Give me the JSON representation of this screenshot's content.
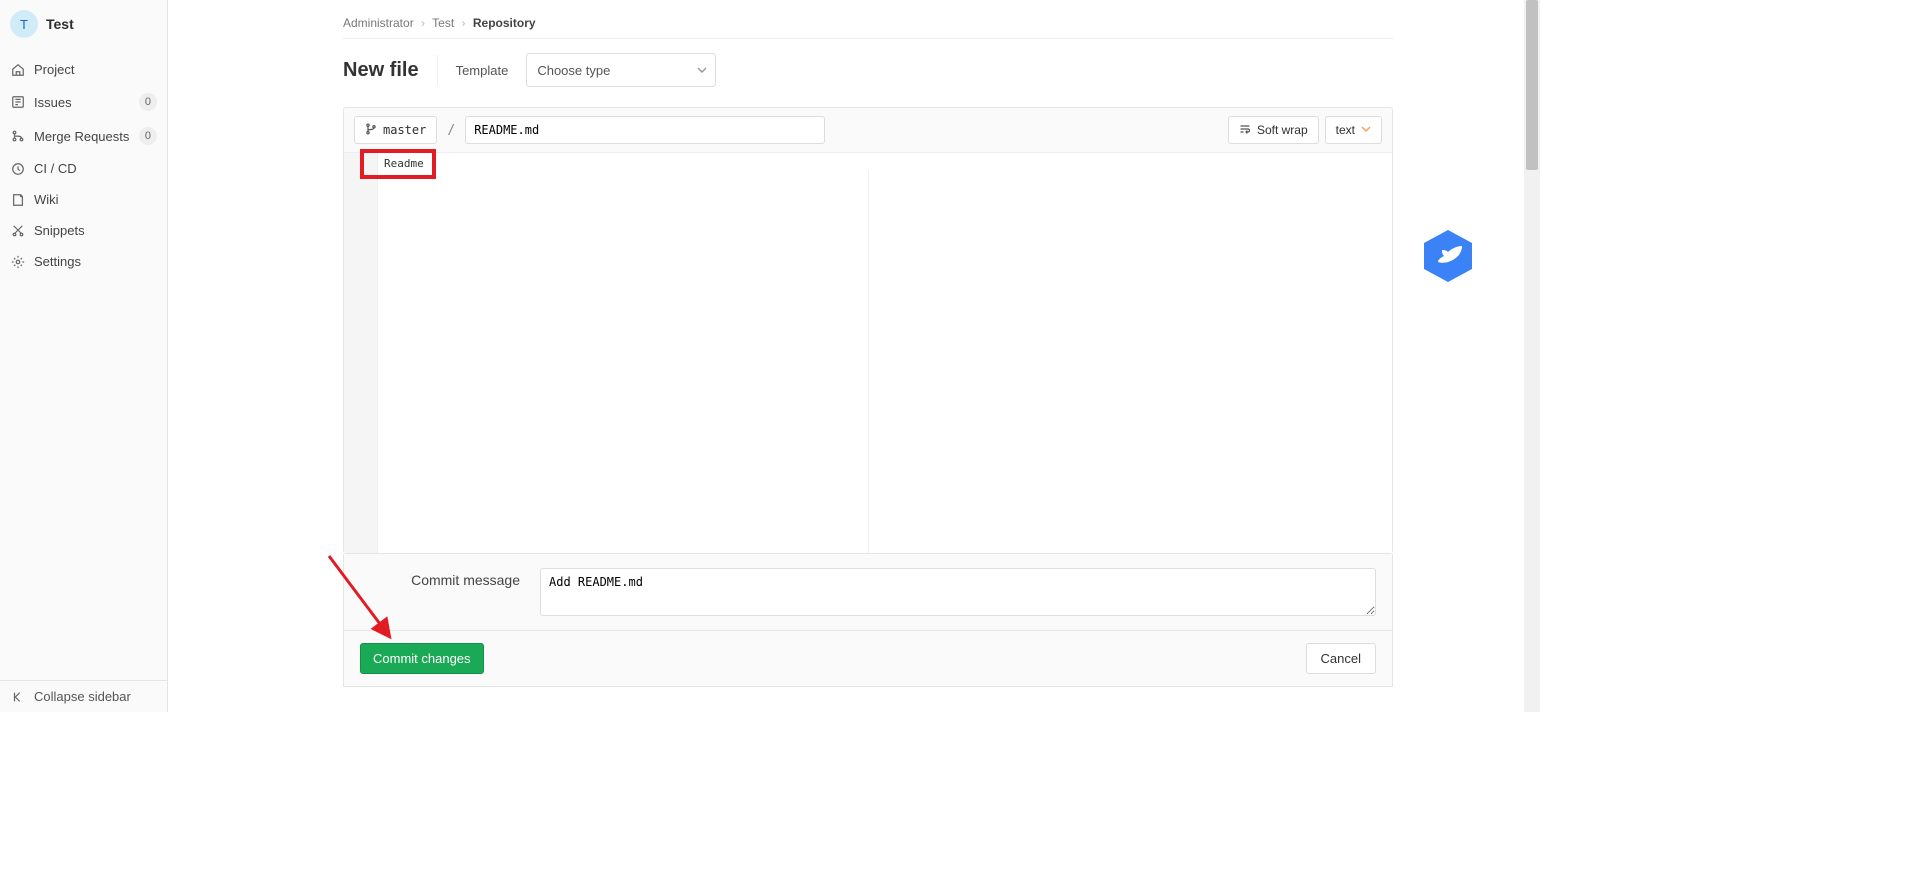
{
  "sidebar": {
    "project_avatar_letter": "T",
    "project_name": "Test",
    "items": [
      {
        "label": "Project",
        "icon": "home"
      },
      {
        "label": "Issues",
        "icon": "issues",
        "badge": "0"
      },
      {
        "label": "Merge Requests",
        "icon": "merge",
        "badge": "0"
      },
      {
        "label": "CI / CD",
        "icon": "cicd"
      },
      {
        "label": "Wiki",
        "icon": "wiki"
      },
      {
        "label": "Snippets",
        "icon": "snippets"
      },
      {
        "label": "Settings",
        "icon": "settings"
      }
    ],
    "footer_label": "Collapse sidebar"
  },
  "breadcrumb": {
    "c0": "Administrator",
    "c1": "Test",
    "c2": "Repository"
  },
  "title_row": {
    "title": "New file",
    "template_label": "Template",
    "template_select_placeholder": "Choose type"
  },
  "editor": {
    "branch_name": "master",
    "slash": "/",
    "filename_value": "README.md",
    "softwrap_label": "Soft wrap",
    "mode_label": "text",
    "line1_content": "Readme"
  },
  "commit": {
    "label": "Commit message",
    "message_value": "Add README.md"
  },
  "actions": {
    "commit_btn": "Commit changes",
    "cancel_btn": "Cancel"
  },
  "annotations": {
    "red_box_on_line1": true,
    "red_arrow_to_commit_button": true
  }
}
